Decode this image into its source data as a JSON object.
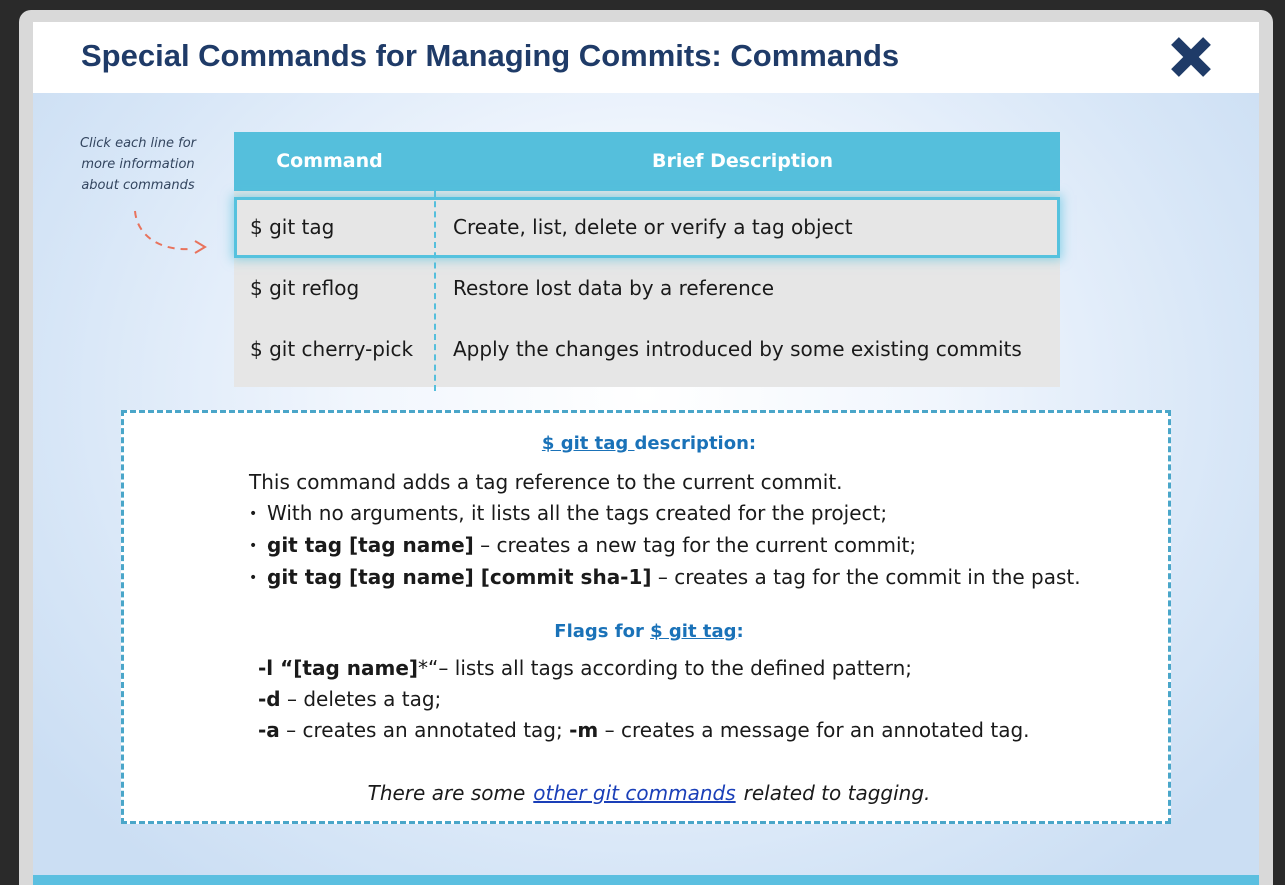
{
  "dialog": {
    "title": "Special Commands for Managing Commits: Commands"
  },
  "hint": {
    "line1": "Click each line for",
    "line2": "more information",
    "line3": "about commands"
  },
  "table": {
    "headers": [
      "Command",
      "Brief Description"
    ],
    "rows": [
      {
        "command": "$ git tag",
        "description": "Create, list, delete or verify a tag object",
        "selected": true
      },
      {
        "command": "$ git reflog",
        "description": "Restore lost data by a reference",
        "selected": false
      },
      {
        "command": "$ git cherry-pick",
        "description": "Apply the changes introduced by some existing commits",
        "selected": false
      }
    ]
  },
  "details": {
    "title_link": "$ git tag ",
    "title_rest": "description:",
    "intro": "This command adds a tag reference to the current commit.",
    "bullets": [
      {
        "bold": "",
        "text": "With no arguments, it lists all the tags created for the project;"
      },
      {
        "bold": "git tag [tag name]",
        "text": " – creates a new tag for the current commit;"
      },
      {
        "bold": "git tag [tag name] [commit sha-1]",
        "text": " – creates a tag for the commit in the past."
      }
    ],
    "flags_title_prefix": "Flags for ",
    "flags_title_link": "$ git tag",
    "flags_title_suffix": ":",
    "flags": {
      "l_bold": "-l “[tag name]",
      "l_star": "*“",
      "l_text": "– lists all tags according to the defined pattern;",
      "d_bold": "-d",
      "d_text": " – deletes a tag;",
      "a_bold": "-a",
      "a_text": " – creates an annotated tag; ",
      "m_bold": "-m",
      "m_text": " – creates a message for an annotated tag."
    },
    "footer_prefix": "There are some",
    "footer_link": "other git commands",
    "footer_suffix": "related to tagging."
  },
  "colors": {
    "title": "#1f3b68",
    "table_header": "#55bfdc",
    "accent_link": "#1a72b8"
  },
  "icons": {
    "close": "close-x-icon",
    "hint_arrow": "curved-dashed-arrow-icon"
  }
}
